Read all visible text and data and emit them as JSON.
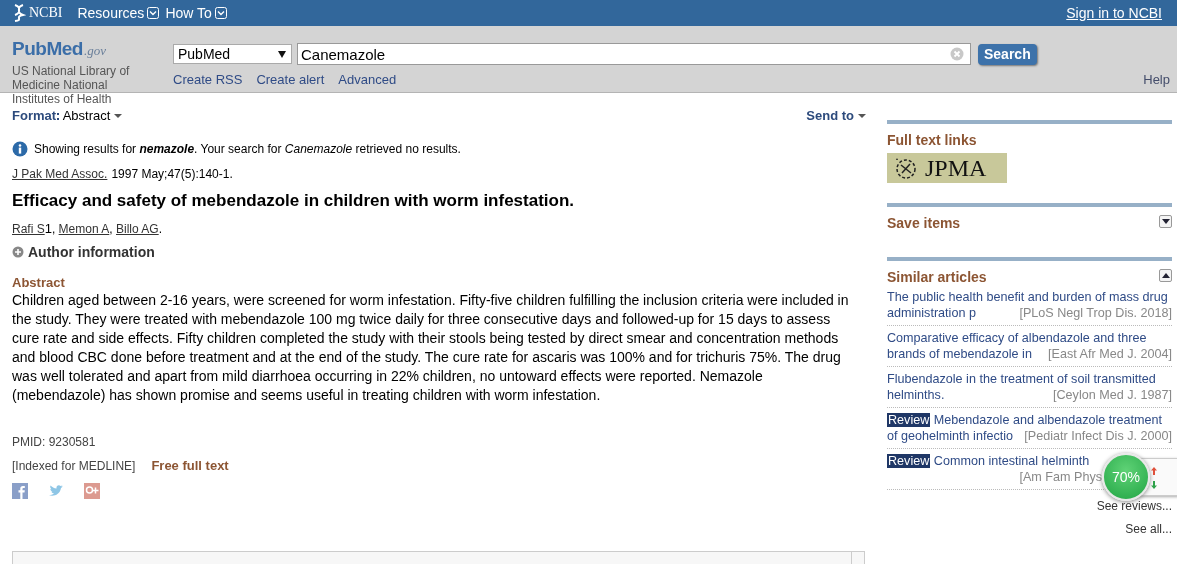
{
  "header": {
    "logo": "NCBI",
    "menus": [
      {
        "label": "Resources"
      },
      {
        "label": "How To"
      }
    ],
    "signin": "Sign in to NCBI"
  },
  "search": {
    "logo_main": "PubMed",
    "logo_suffix": ".gov",
    "org": "US National Library of Medicine National Institutes of Health",
    "database": "PubMed",
    "value": "Canemazole",
    "button": "Search",
    "links": [
      "Create RSS",
      "Create alert",
      "Advanced"
    ],
    "help": "Help"
  },
  "format": {
    "label": "Format",
    "value": "Abstract"
  },
  "send_to": "Send to",
  "notice": "Showing results for **nemazole**. Your search for *Canemazole* retrieved no results.",
  "citation": {
    "journal": "J Pak Med Assoc.",
    "details": "1997 May;47(5):140-1."
  },
  "title": "Efficacy and safety of mebendazole in children with worm infestation.",
  "authors": [
    {
      "name": "Rafi S",
      "sup": "1",
      "after": ","
    },
    {
      "name": "Memon A",
      "after": ","
    },
    {
      "name": "Billo AG",
      "after": "."
    }
  ],
  "author_info": {
    "label": "Author information",
    "expanded": false
  },
  "abstract": {
    "heading": "Abstract",
    "text": "Children aged between 2-16 years, were screened for worm infestation. Fifty-five children fulfilling the inclusion criteria were included in the study. They were treated with mebendazole 100 mg twice daily for three consecutive days and followed-up for 15 days to assess cure rate and side effects. Fifty children completed the study with their stools being tested by direct smear and concentration methods and blood CBC done before treatment and at the end of the study. The cure rate for ascaris was 100% and for trichuris 75%. The drug was well tolerated and apart from mild diarrhoea occurring in 22% children, no untoward effects were reported. Nemazole (mebendazole) has shown promise and seems useful in treating children with worm infestation."
  },
  "pmid": "PMID: 9230581",
  "indexed": "[Indexed for MEDLINE]",
  "free_full_text": "Free full text",
  "sidebar": {
    "full_text": {
      "title": "Full text links",
      "logo": "JPMA"
    },
    "save_items": {
      "title": "Save items",
      "expanded": false
    },
    "similar": {
      "title": "Similar articles",
      "expanded": true,
      "items": [
        {
          "title": "The public health benefit and burden of mass drug administration p",
          "journal": "[PLoS Negl Trop Dis. 2018]"
        },
        {
          "title": "Comparative efficacy of albendazole and three brands of mebendazole in",
          "journal": "[East Afr Med J. 2004]"
        },
        {
          "title": "Flubendazole in the treatment of soil transmitted helminths.",
          "journal": "[Ceylon Med J. 1987]"
        },
        {
          "badge": "Review",
          "title": "Mebendazole and albendazole treatment of geohelminth infectio",
          "journal": "[Pediatr Infect Dis J. 2000]"
        },
        {
          "badge": "Review",
          "title": "Common intestinal helminth",
          "journal": "[Am Fam Phys"
        }
      ],
      "see_reviews": "See reviews...",
      "see_all": "See all..."
    }
  },
  "widget": {
    "percent": "70%"
  }
}
